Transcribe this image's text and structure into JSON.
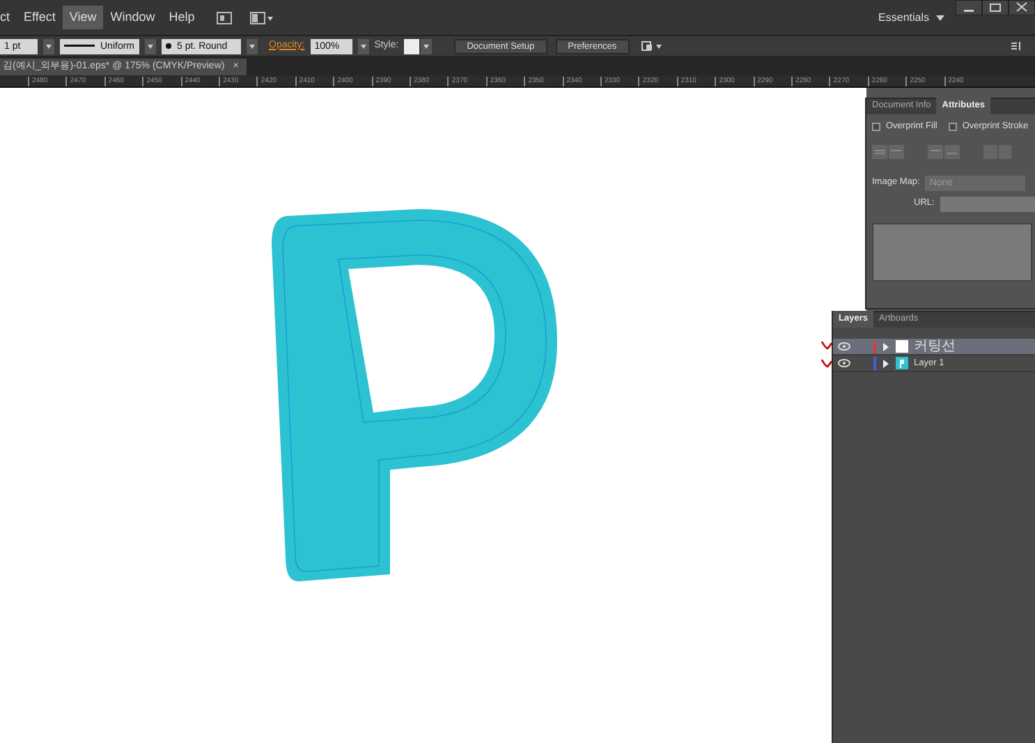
{
  "menu_bar": {
    "items": [
      {
        "label": "ct",
        "selected": false
      },
      {
        "label": "Effect",
        "selected": false
      },
      {
        "label": "View",
        "selected": true
      },
      {
        "label": "Window",
        "selected": false
      },
      {
        "label": "Help",
        "selected": false
      }
    ],
    "workspace": "Essentials"
  },
  "control_bar": {
    "stroke_weight": "1 pt",
    "profile": "Uniform",
    "brush": "5 pt. Round",
    "opacity_label": "Opacity:",
    "opacity": "100%",
    "style_label": "Style:",
    "buttons": [
      "Document Setup",
      "Preferences"
    ]
  },
  "document_tab": {
    "title": "김(예시_외부용)-01.eps* @ 175% (CMYK/Preview)",
    "close": "×"
  },
  "ruler": {
    "labels": [
      "2480",
      "2470",
      "2460",
      "2450",
      "2440",
      "2430",
      "2420",
      "2410",
      "2400",
      "2390",
      "2380",
      "2370",
      "2360",
      "2350",
      "2340",
      "2330",
      "2320",
      "2310",
      "2300",
      "2290",
      "2280",
      "2270",
      "2260",
      "2250",
      "2240"
    ]
  },
  "attributes_panel": {
    "tabs": [
      {
        "label": "Document Info",
        "selected": false
      },
      {
        "label": "Attributes",
        "selected": true
      }
    ],
    "checkboxes": [
      {
        "label": "Overprint Fill",
        "checked": false
      },
      {
        "label": "Overprint Stroke",
        "checked": false
      }
    ],
    "image_map_label": "Image Map:",
    "image_map": "None",
    "url_label": "URL:"
  },
  "layers_panel": {
    "tabs": [
      {
        "label": "Layers",
        "selected": true
      },
      {
        "label": "Artboards",
        "selected": false
      }
    ],
    "layers": [
      {
        "name": "커팅선",
        "color": "#d04040",
        "visible": true,
        "selected": true,
        "marked": true
      },
      {
        "name": "Layer 1",
        "color": "#4060d0",
        "visible": true,
        "selected": false,
        "marked": true
      }
    ]
  }
}
